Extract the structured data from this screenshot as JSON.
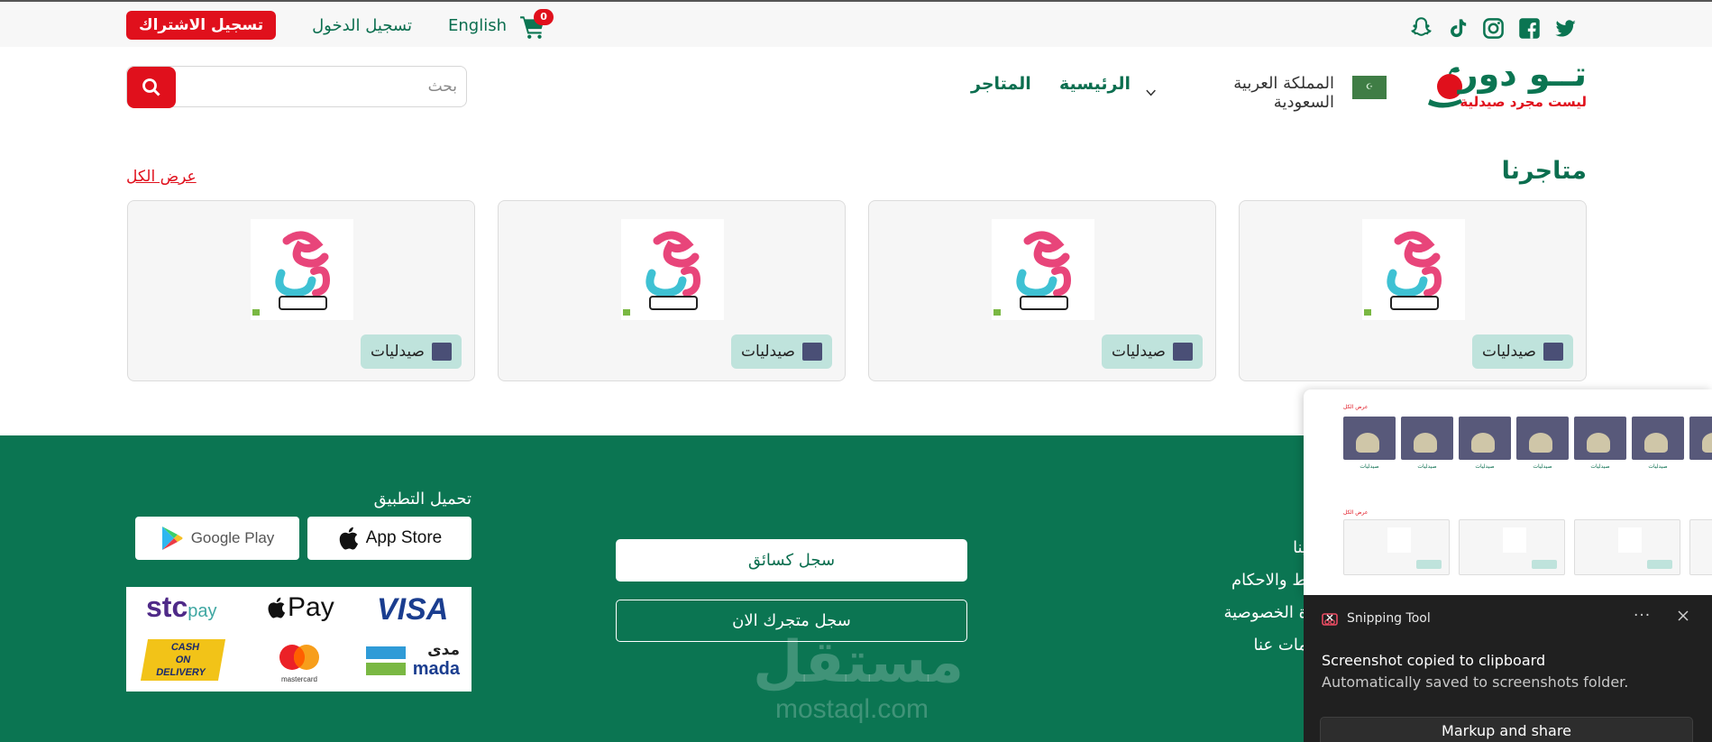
{
  "colors": {
    "brand_green": "#0b7552",
    "accent_red": "#e0101c",
    "badge_mint": "#bfe3dc",
    "card_bg": "#f6f6f6",
    "toast_bg": "#202020"
  },
  "topbar": {
    "social_icons": [
      "snapchat-icon",
      "tiktok-icon",
      "instagram-icon",
      "facebook-icon",
      "twitter-icon"
    ],
    "subscribe_label": "تسجيل الاشتراك",
    "login_label": "تسجيل الدخول",
    "language_label": "English",
    "cart_count": "0"
  },
  "header": {
    "logo_title": "تــو دور",
    "logo_subtitle": "ليست مجرد صيدلية",
    "country_label": "المملكة العربية السعودية",
    "nav_home": "الرئيسية",
    "nav_stores": "المتاجر",
    "search_placeholder": "بحث"
  },
  "stores_section": {
    "title": "متاجرنا",
    "view_all": "عرض الكل",
    "cards": [
      {
        "category_label": "صيدليات"
      },
      {
        "category_label": "صيدليات"
      },
      {
        "category_label": "صيدليات"
      },
      {
        "category_label": "صيدليات"
      }
    ]
  },
  "footer": {
    "download_title": "تحميل التطبيق",
    "google_play_label": "Google Play",
    "app_store_label": "App Store",
    "payments": {
      "stc": "stc",
      "stc_pay": "pay",
      "apple_pay": "Pay",
      "visa": "VISA",
      "cod_line1": "CASH",
      "cod_line2": "ON",
      "cod_line3": "DELIVERY",
      "mastercard": "mastercard",
      "mada_ar": "مدى",
      "mada_en": "mada"
    },
    "register_driver": "سجل كسائق",
    "register_store": "سجل متجرك الان",
    "links": [
      "ينا",
      "ط والاحكام",
      "ة الخصوصية",
      "مات عنا"
    ],
    "watermark_ar": "مستقل",
    "watermark_en": "mostaql.com"
  },
  "snip_preview": {
    "title": "عرض الكل",
    "thumb_caption": "صيدليات"
  },
  "toast": {
    "app_name": "Snipping Tool",
    "more_label": "···",
    "title": "Screenshot copied to clipboard",
    "body": "Automatically saved to screenshots folder.",
    "action_label": "Markup and share"
  }
}
